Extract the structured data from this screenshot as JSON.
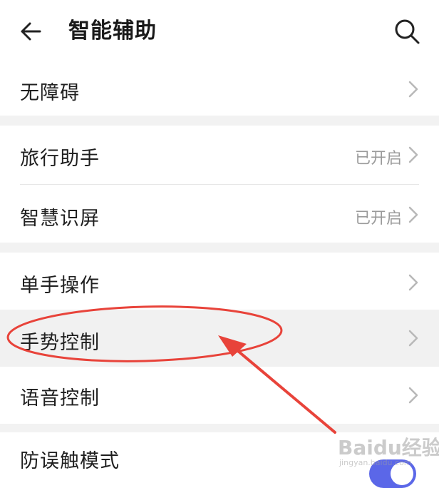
{
  "header": {
    "title": "智能辅助"
  },
  "sections": [
    {
      "items": [
        {
          "label": "无障碍",
          "status": ""
        }
      ]
    },
    {
      "items": [
        {
          "label": "旅行助手",
          "status": "已开启"
        },
        {
          "label": "智慧识屏",
          "status": "已开启"
        }
      ]
    },
    {
      "items": [
        {
          "label": "单手操作",
          "status": ""
        },
        {
          "label": "手势控制",
          "status": ""
        },
        {
          "label": "语音控制",
          "status": ""
        }
      ]
    },
    {
      "items": [
        {
          "label": "防误触模式",
          "toggle_on": true
        }
      ]
    }
  ],
  "annotation": {
    "color": "#e8433a",
    "target": "手势控制"
  },
  "colors": {
    "accent": "#5b67e8",
    "annotation": "#e8433a"
  },
  "watermark": {
    "text": "Baidu经验",
    "subtext": "jingyan.baidu.com"
  }
}
